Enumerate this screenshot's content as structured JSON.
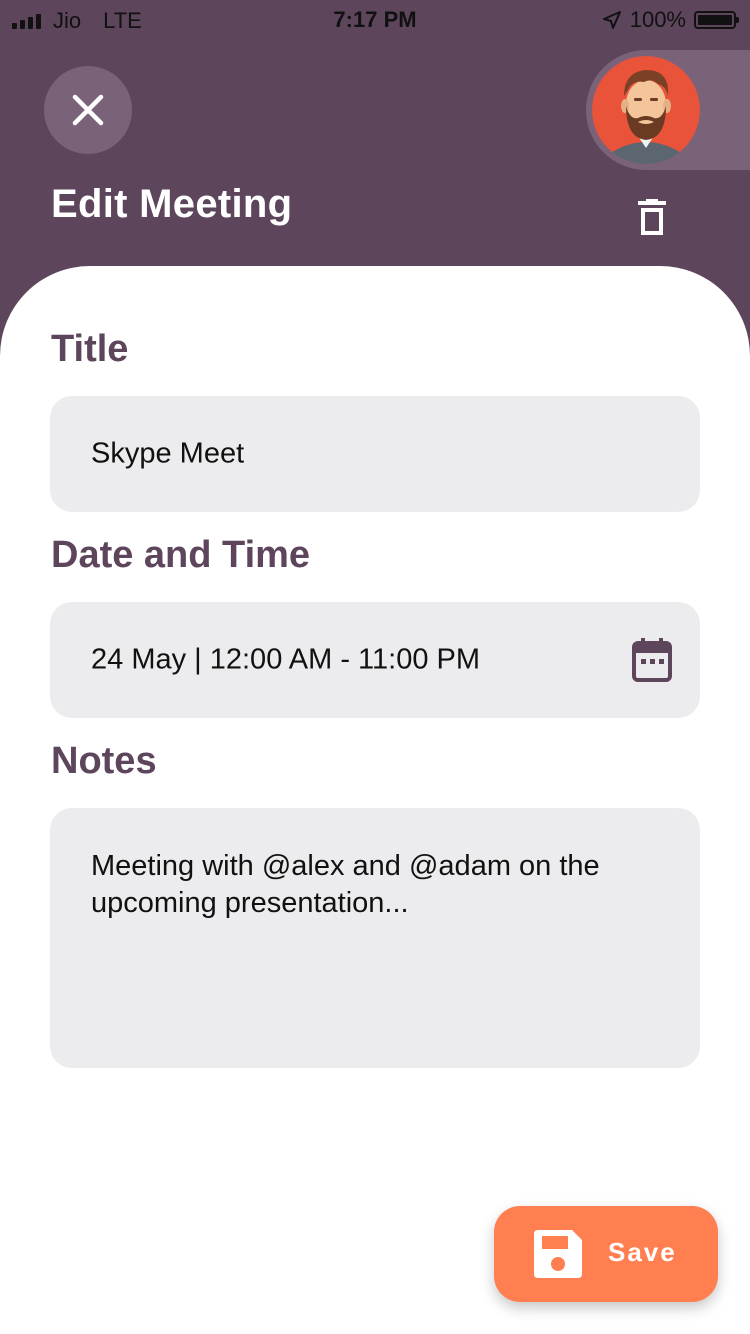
{
  "status_bar": {
    "carrier": "Jio",
    "network": "LTE",
    "time": "7:17 PM",
    "battery": "100%"
  },
  "header": {
    "title": "Edit Meeting",
    "close_icon": "close-icon",
    "delete_icon": "trash-icon",
    "avatar_icon": "bearded-man-avatar"
  },
  "form": {
    "title": {
      "label": "Title",
      "value": "Skype Meet"
    },
    "datetime": {
      "label": "Date and Time",
      "value": "24 May | 12:00 AM - 11:00 PM",
      "icon": "calendar-icon"
    },
    "notes": {
      "label": "Notes",
      "value": "Meeting with @alex and @adam on the upcoming presentation..."
    }
  },
  "actions": {
    "save_label": "Save",
    "save_icon": "floppy-disk-icon"
  },
  "colors": {
    "header": "#5d455c",
    "header_light": "#7a6379",
    "field_bg": "#ecebed",
    "accent": "#ff7f50",
    "avatar_bg": "#e8533a"
  }
}
